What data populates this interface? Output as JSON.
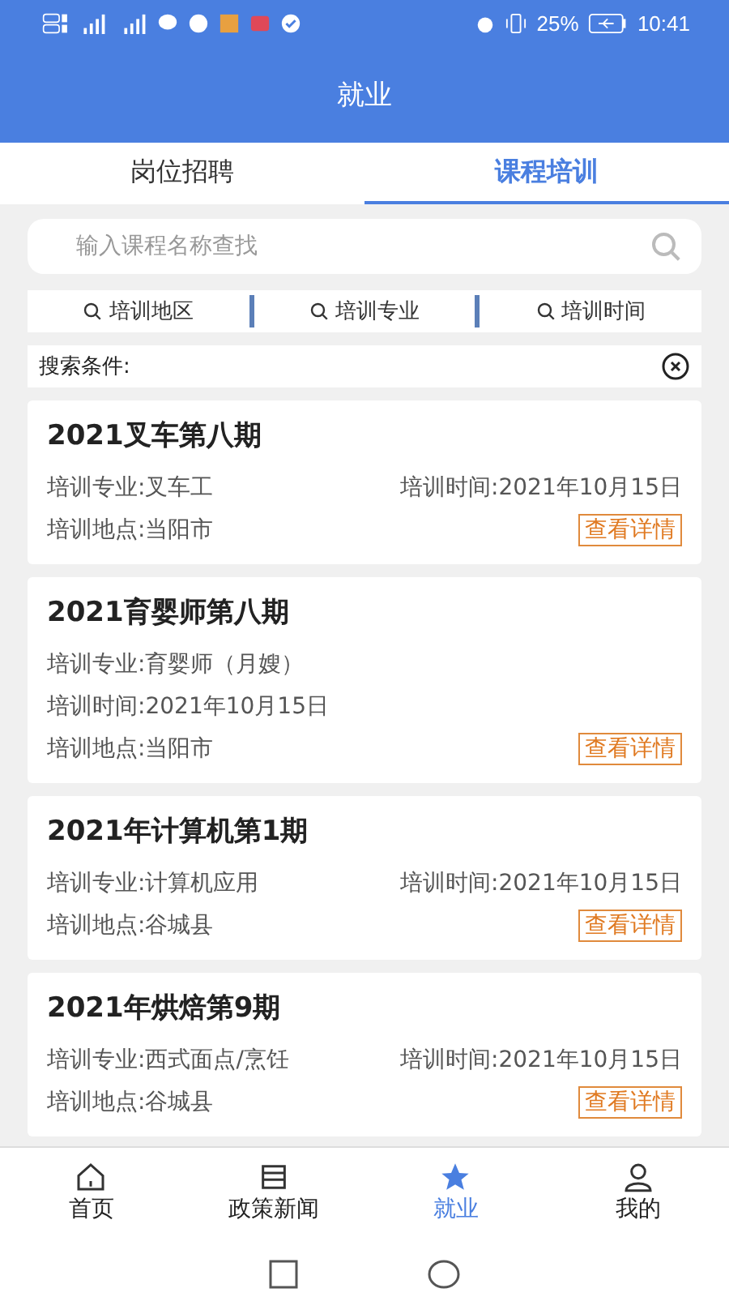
{
  "status_bar": {
    "battery": "25%",
    "time": "10:41"
  },
  "header": {
    "title": "就业"
  },
  "tabs": [
    {
      "label": "岗位招聘",
      "selected": false
    },
    {
      "label": "课程培训",
      "selected": true
    }
  ],
  "search": {
    "placeholder": "输入课程名称查找"
  },
  "filters": [
    "培训地区",
    "培训专业",
    "培训时间"
  ],
  "conditions": {
    "label": "搜索条件:"
  },
  "courses": [
    {
      "title": "2021叉车第八期",
      "lines": [
        [
          "培训专业:叉车工",
          "培训时间:2021年10月15日"
        ],
        [
          "培训地点:当阳市"
        ]
      ],
      "button": "查看详情"
    },
    {
      "title": "2021育婴师第八期",
      "lines": [
        [
          "培训专业:育婴师（月嫂）"
        ],
        [
          "培训时间:2021年10月15日"
        ],
        [
          "培训地点:当阳市"
        ]
      ],
      "button": "查看详情"
    },
    {
      "title": "2021年计算机第1期",
      "lines": [
        [
          "培训专业:计算机应用",
          "培训时间:2021年10月15日"
        ],
        [
          "培训地点:谷城县"
        ]
      ],
      "button": "查看详情"
    },
    {
      "title": "2021年烘焙第9期",
      "lines": [
        [
          "培训专业:西式面点/烹饪",
          "培训时间:2021年10月15日"
        ],
        [
          "培训地点:谷城县"
        ]
      ],
      "button": "查看详情"
    }
  ],
  "nav": [
    {
      "label": "首页",
      "kind": "home",
      "selected": false
    },
    {
      "label": "政策新闻",
      "kind": "news",
      "selected": false
    },
    {
      "label": "就业",
      "kind": "star",
      "selected": true
    },
    {
      "label": "我的",
      "kind": "person",
      "selected": false
    }
  ]
}
